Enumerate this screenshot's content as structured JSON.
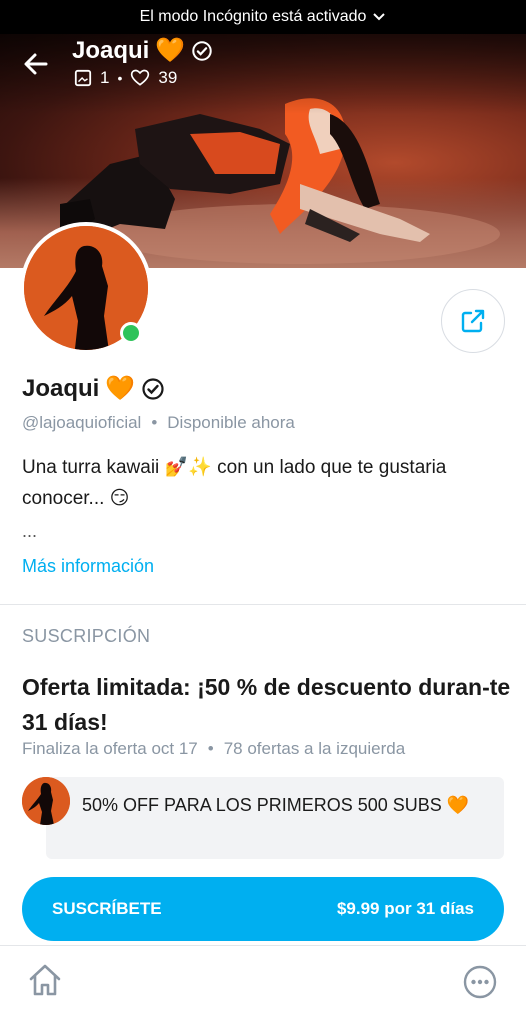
{
  "system_bar": {
    "incognito_text": "El modo Incógnito está activado"
  },
  "profile": {
    "name": "Joaqui",
    "heart_emoji": "🧡",
    "media_count": "1",
    "likes_count": "39",
    "handle": "@lajoaquioficial",
    "availability": "Disponible ahora",
    "bio": "Una turra kawaii 💅✨ con un lado que te gustaria conocer... 😏",
    "bio_more": "...",
    "more_info_label": "Más información"
  },
  "subscription": {
    "section_title": "SUSCRIPCIÓN",
    "offer_title": "Oferta limitada: ¡50 % de descuento duran-te 31 días!",
    "offer_end": "Finaliza la oferta oct 17",
    "offers_left": "78 ofertas a la izquierda",
    "promo_message": "50% OFF PARA LOS PRIMEROS 500 SUBS 🧡",
    "subscribe_label": "SUSCRÍBETE",
    "price_label": "$9.99 por 31 días"
  },
  "colors": {
    "accent": "#00aff0",
    "online": "#2ec35a",
    "muted": "#8a96a3"
  },
  "icons": [
    "back-arrow-icon",
    "verified-icon",
    "image-icon",
    "heart-icon",
    "share-icon",
    "home-icon",
    "more-options-icon",
    "chevron-down-icon"
  ]
}
